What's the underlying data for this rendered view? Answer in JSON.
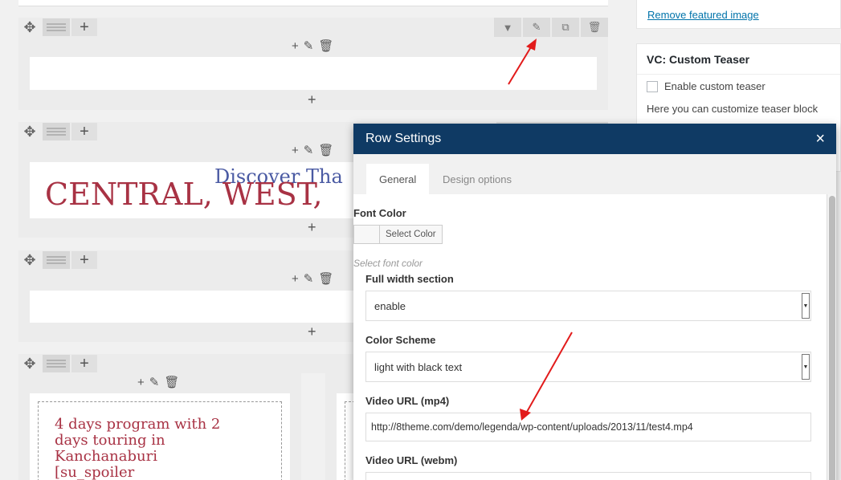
{
  "sidebar": {
    "remove_featured_image": "Remove featured image",
    "teaser_title": "VC: Custom Teaser",
    "enable_teaser_label": "Enable custom teaser",
    "teaser_hint": "Here you can customize teaser block"
  },
  "rows": {
    "row2_text_back": "Discover Tha",
    "row2_text_front": "CENTRAL, WEST,",
    "row4_text": [
      "4 days program with 2",
      "days touring in",
      "Kanchanaburi",
      "[su_spoiler"
    ]
  },
  "modal": {
    "title": "Row Settings",
    "close": "×",
    "tabs": [
      "General",
      "Design options"
    ],
    "font_color_label": "Font Color",
    "select_color_button": "Select Color",
    "font_color_hint": "Select font color",
    "full_width_label": "Full width section",
    "full_width_value": "enable",
    "color_scheme_label": "Color Scheme",
    "color_scheme_value": "light with black text",
    "video_mp4_label": "Video URL (mp4)",
    "video_mp4_value": "http://8theme.com/demo/legenda/wp-content/uploads/2013/11/test4.mp4",
    "video_webm_label": "Video URL (webm)"
  },
  "colors": {
    "modal_header": "#0f3a64",
    "heading_red": "#a83244",
    "heading_blue": "#4a5aa3",
    "arrow_red": "#e21b1b"
  },
  "icons": [
    "move-icon",
    "layout-icon",
    "plus-icon",
    "pencil-icon",
    "trash-icon",
    "clone-icon",
    "chevron-down-icon",
    "close-icon"
  ]
}
